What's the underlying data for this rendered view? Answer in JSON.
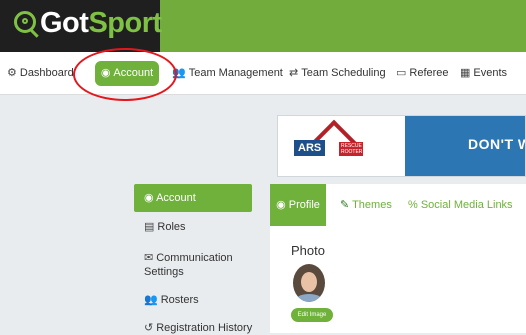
{
  "brand": {
    "got": "Got",
    "sport": "Sport",
    "accent": "#6fb13b"
  },
  "nav": {
    "items": [
      {
        "icon": "dashboard-icon",
        "glyph": "⚙",
        "label": "Dashboard"
      },
      {
        "icon": "user-circle-icon",
        "glyph": "◉",
        "label": "Account"
      },
      {
        "icon": "users-icon",
        "glyph": "👥",
        "label": "Team Management"
      },
      {
        "icon": "swap-icon",
        "glyph": "⇄",
        "label": "Team Scheduling"
      },
      {
        "icon": "calendar-icon",
        "glyph": "▭",
        "label": "Referee"
      },
      {
        "icon": "calendar-grid-icon",
        "glyph": "▦",
        "label": "Events"
      }
    ]
  },
  "ad": {
    "brand": "ARS",
    "sub": "RESCUE ROOTER",
    "headline": "DON'T W"
  },
  "sidebar": {
    "items": [
      {
        "icon": "user-circle-icon",
        "glyph": "◉",
        "label": "Account"
      },
      {
        "icon": "id-card-icon",
        "glyph": "▤",
        "label": "Roles"
      },
      {
        "icon": "envelope-icon",
        "glyph": "✉",
        "label": "Communication Settings"
      },
      {
        "icon": "users-icon",
        "glyph": "👥",
        "label": "Rosters"
      },
      {
        "icon": "history-icon",
        "glyph": "↺",
        "label": "Registration History"
      }
    ]
  },
  "tabs": [
    {
      "icon": "user-circle-icon",
      "glyph": "◉",
      "label": "Profile"
    },
    {
      "icon": "brush-icon",
      "glyph": "✎",
      "label": "Themes"
    },
    {
      "icon": "link-icon",
      "glyph": "%",
      "label": "Social Media Links"
    }
  ],
  "profile": {
    "photo_label": "Photo",
    "edit_image_label": "Edit Image"
  }
}
